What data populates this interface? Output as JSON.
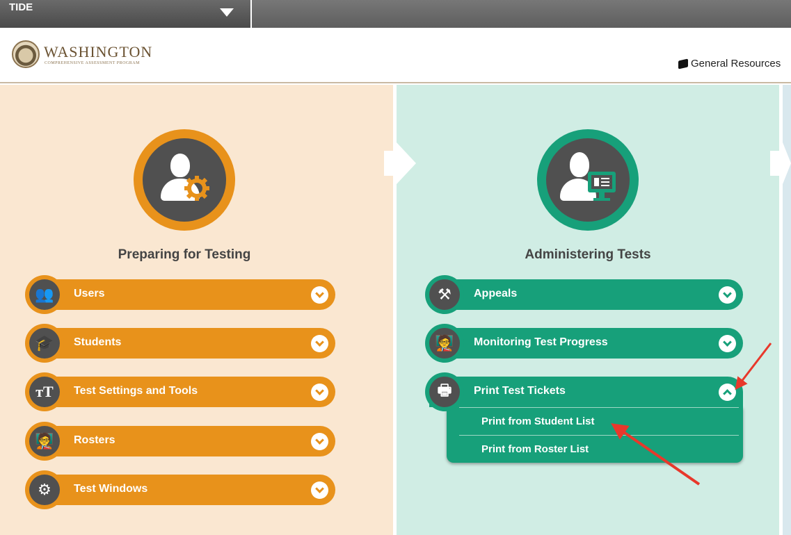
{
  "topbar": {
    "app_name": "TIDE"
  },
  "header": {
    "logo_title": "WASHINGTON",
    "logo_subtitle": "COMPREHENSIVE ASSESSMENT PROGRAM",
    "general_resources": "General Resources"
  },
  "prep": {
    "title": "Preparing for Testing",
    "items": [
      {
        "label": "Users",
        "icon": "users-icon"
      },
      {
        "label": "Students",
        "icon": "graduation-cap-icon"
      },
      {
        "label": "Test Settings and Tools",
        "icon": "text-size-icon"
      },
      {
        "label": "Rosters",
        "icon": "classroom-icon"
      },
      {
        "label": "Test Windows",
        "icon": "gear-calendar-icon"
      }
    ]
  },
  "admin": {
    "title": "Administering Tests",
    "items": [
      {
        "label": "Appeals",
        "icon": "gavel-gear-icon"
      },
      {
        "label": "Monitoring Test Progress",
        "icon": "classroom-icon"
      },
      {
        "label": "Print Test Tickets",
        "icon": "printer-icon"
      }
    ],
    "print_submenu": [
      "Print from Student List",
      "Print from Roster List"
    ]
  },
  "colors": {
    "orange": "#e8921b",
    "green": "#17a07a",
    "annotation": "#e8382b"
  }
}
